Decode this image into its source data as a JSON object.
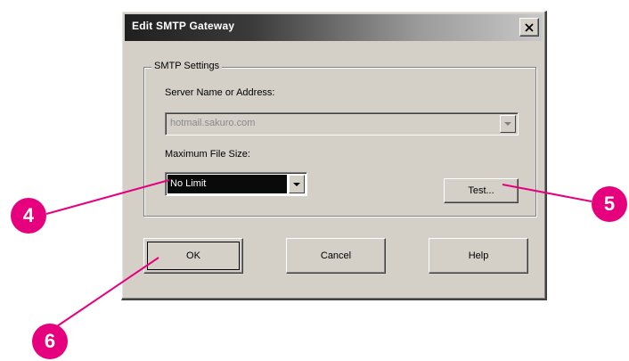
{
  "dialog": {
    "title": "Edit SMTP Gateway",
    "close_glyph": "✕"
  },
  "group": {
    "legend": "SMTP Settings",
    "server_label": "Server Name or Address:",
    "server_value": "hotmail.sakuro.com",
    "max_size_label": "Maximum File Size:",
    "max_size_value": "No Limit",
    "test_button": "Test..."
  },
  "buttons": {
    "ok": "OK",
    "cancel": "Cancel",
    "help": "Help"
  },
  "callouts": {
    "c4": "4",
    "c5": "5",
    "c6": "6",
    "color": "#e6007e"
  },
  "icons": {
    "close": "close-icon",
    "dropdown": "chevron-down-icon"
  }
}
